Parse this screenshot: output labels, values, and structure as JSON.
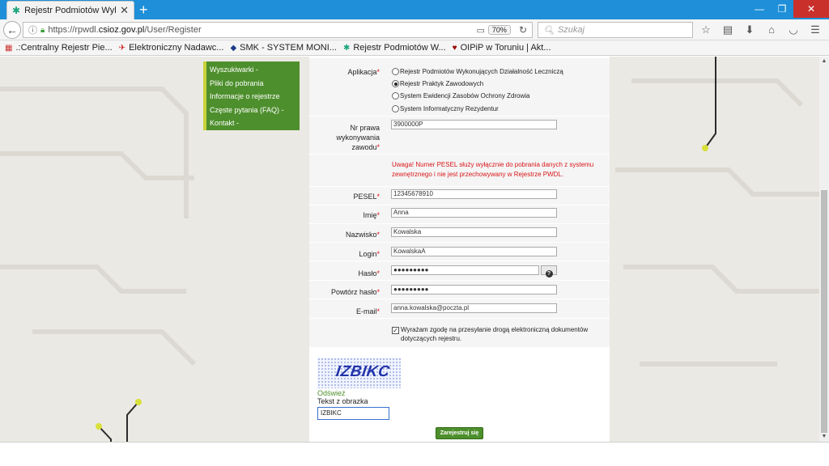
{
  "browser": {
    "tab_title": "Rejestr Podmiotów Wykonuj",
    "url_prefix": "https://rpwdl.",
    "url_host": "csioz.gov.pl",
    "url_path": "/User/Register",
    "zoom": "70%",
    "search_placeholder": "Szukaj",
    "bookmarks": [
      {
        "label": ".:Centralny Rejestr Pie...",
        "icon": "page-icon"
      },
      {
        "label": "Elektroniczny Nadawc...",
        "icon": "bird-icon"
      },
      {
        "label": "SMK - SYSTEM MONI...",
        "icon": "smk-icon"
      },
      {
        "label": "Rejestr Podmiotów W...",
        "icon": "asterisk-icon"
      },
      {
        "label": "OIPiP w Toruniu | Akt...",
        "icon": "oipip-icon"
      }
    ]
  },
  "menu": {
    "items": [
      "Wyszukiwarki -",
      "Pliki do pobrania",
      "Informacje o rejestrze",
      "Częste pytania (FAQ) -",
      "Kontakt -"
    ]
  },
  "form": {
    "application_label": "Aplikacja",
    "applications": [
      {
        "label": "Rejestr Podmiotów Wykonujących Działalność Leczniczą",
        "selected": false
      },
      {
        "label": "Rejestr Praktyk Zawodowych",
        "selected": true
      },
      {
        "label": "System Ewidencji Zasobów Ochrony Zdrowia",
        "selected": false
      },
      {
        "label": "System Informatyczny Rezydentur",
        "selected": false
      }
    ],
    "license_label": "Nr prawa wykonywania zawodu",
    "license_value": "3900000P",
    "warning": "Uwaga! Numer PESEL służy wyłącznie do pobrania danych z systemu zewnętrznego i nie jest przechowywany w Rejestrze PWDL.",
    "pesel_label": "PESEL",
    "pesel_value": "12345678910",
    "first_name_label": "Imię",
    "first_name_value": "Anna",
    "last_name_label": "Nazwisko",
    "last_name_value": "Kowalska",
    "login_label": "Login",
    "login_value": "KowalskaA",
    "password_label": "Hasło",
    "password_value": "●●●●●●●●●",
    "password_repeat_label": "Powtórz hasło",
    "password_repeat_value": "●●●●●●●●●",
    "email_label": "E-mail",
    "email_value": "anna.kowalska@poczta.pl",
    "consent_checked": true,
    "consent_text": "Wyrażam zgodę na przesyłanie drogą elektroniczną dokumentów dotyczących rejestru.",
    "captcha_text": "IZBIKC",
    "refresh_label": "Odśwież",
    "captcha_label": "Tekst z obrazka",
    "captcha_input": "IZBIKC",
    "submit_label": "Zarejestruj się",
    "required_mark": "*",
    "help_icon_glyph": "?"
  },
  "colors": {
    "menu_green": "#4e8f2d",
    "accent_yellow": "#c9d23a",
    "required_red": "#d9161a",
    "titlebar_blue": "#1e8fd8"
  }
}
